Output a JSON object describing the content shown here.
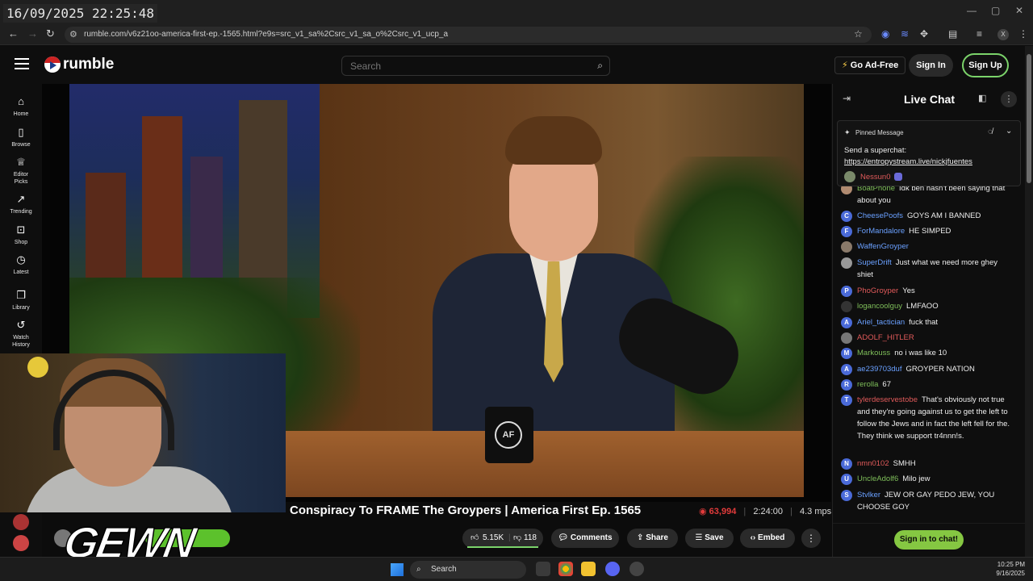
{
  "overlay": {
    "timestamp": "16/09/2025 22:25:48",
    "watermark": "GEWN"
  },
  "browser": {
    "url": "rumble.com/v6z21oo-america-first-ep.-1565.html?e9s=src_v1_sa%2Csrc_v1_sa_o%2Csrc_v1_ucp_a",
    "profile_initial": "X"
  },
  "header": {
    "logo_text": "rumble",
    "search_placeholder": "Search",
    "go_adfree": "Go Ad-Free",
    "sign_in": "Sign In",
    "sign_up": "Sign Up"
  },
  "sidebar": {
    "items": [
      {
        "label": "Home",
        "icon": "home-icon",
        "glyph": "⌂"
      },
      {
        "label": "Browse",
        "icon": "browse-icon",
        "glyph": "▯"
      },
      {
        "label": "Editor Picks",
        "icon": "editor-picks-icon",
        "glyph": "♕"
      },
      {
        "label": "Trending",
        "icon": "trending-icon",
        "glyph": "↗"
      },
      {
        "label": "Shop",
        "icon": "shop-icon",
        "glyph": "⊡"
      },
      {
        "label": "Latest",
        "icon": "latest-icon",
        "glyph": "◷"
      },
      {
        "label": "Library",
        "icon": "library-icon",
        "glyph": "❐"
      },
      {
        "label": "Watch History",
        "icon": "watch-history-icon",
        "glyph": "↺"
      }
    ]
  },
  "video": {
    "mug_logo": "AF",
    "title": "Conspiracy To FRAME The Groypers | America First Ep. 1565",
    "viewers": "63,994",
    "duration": "2:24:00",
    "bitrate": "4.3 mps",
    "likes": "5.15K",
    "dislikes": "118",
    "actions": {
      "comments": "Comments",
      "share": "Share",
      "save": "Save",
      "embed": "Embed"
    }
  },
  "chat": {
    "title": "Live Chat",
    "pinned_label": "Pinned Message",
    "pinned_text": "Send a superchat: ",
    "pinned_link": "https://entropystream.live/nickjfuentes",
    "pinned_user": "Nessun0",
    "signin_button": "Sign in to chat!",
    "messages": [
      {
        "user": "BoatPhone",
        "text": "Idk ben hasn't been saying that about you",
        "color": "#7fbf5a",
        "initial": "",
        "av_color": "#b08a70"
      },
      {
        "user": "CheesePoofs",
        "text": "GOYS AM I BANNED",
        "color": "#6aa0ff",
        "initial": "C",
        "av_color": "#4a6ad8"
      },
      {
        "user": "ForMandalore",
        "text": "HE SIMPED",
        "color": "#6aa0ff",
        "initial": "F",
        "av_color": "#4a6ad8"
      },
      {
        "user": "WaffenGroyper",
        "text": "",
        "color": "#6aa0ff",
        "initial": "",
        "av_color": "#8a7a6a"
      },
      {
        "user": "SuperDrift",
        "text": "Just what we need more ghey shiet",
        "color": "#6aa0ff",
        "initial": "",
        "av_color": "#999"
      },
      {
        "user": "PhoGroyper",
        "text": "Yes",
        "color": "#e05a5a",
        "initial": "P",
        "av_color": "#4a6ad8"
      },
      {
        "user": "logancoolguy",
        "text": "LMFAOO",
        "color": "#7fbf5a",
        "initial": "",
        "av_color": "#333"
      },
      {
        "user": "Ariel_tactician",
        "text": "fuck that",
        "color": "#6aa0ff",
        "initial": "A",
        "av_color": "#4a6ad8"
      },
      {
        "user": "ADOLF_HITLER",
        "text": "",
        "color": "#e05a5a",
        "initial": "",
        "av_color": "#777"
      },
      {
        "user": "Markouss",
        "text": "no i was like 10",
        "color": "#7fbf5a",
        "initial": "M",
        "av_color": "#4a6ad8"
      },
      {
        "user": "ae239703duf",
        "text": "GROYPER NATION",
        "color": "#6aa0ff",
        "initial": "A",
        "av_color": "#4a6ad8"
      },
      {
        "user": "rerolla",
        "text": "67",
        "color": "#7fbf5a",
        "initial": "R",
        "av_color": "#4a6ad8"
      },
      {
        "user": "tylerdeservestobe",
        "text": "That's obviously not true and they're going against us to get the left to follow the Jews and in fact the left fell for the. They think we support tr4nnn!s.",
        "color": "#e05a5a",
        "initial": "T",
        "av_color": "#4a6ad8"
      },
      {
        "user": "nmn0102",
        "text": "SMHH",
        "color": "#e05a5a",
        "initial": "N",
        "av_color": "#4a6ad8"
      },
      {
        "user": "UncleAdolf6",
        "text": "Milo jew",
        "color": "#7fbf5a",
        "initial": "U",
        "av_color": "#4a6ad8"
      },
      {
        "user": "Stvlker",
        "text": "JEW OR GAY PEDO JEW, YOU CHOOSE GOY",
        "color": "#6aa0ff",
        "initial": "S",
        "av_color": "#4a6ad8"
      }
    ]
  },
  "taskbar": {
    "search": "Search",
    "time": "10:25 PM",
    "date": "9/16/2025"
  }
}
